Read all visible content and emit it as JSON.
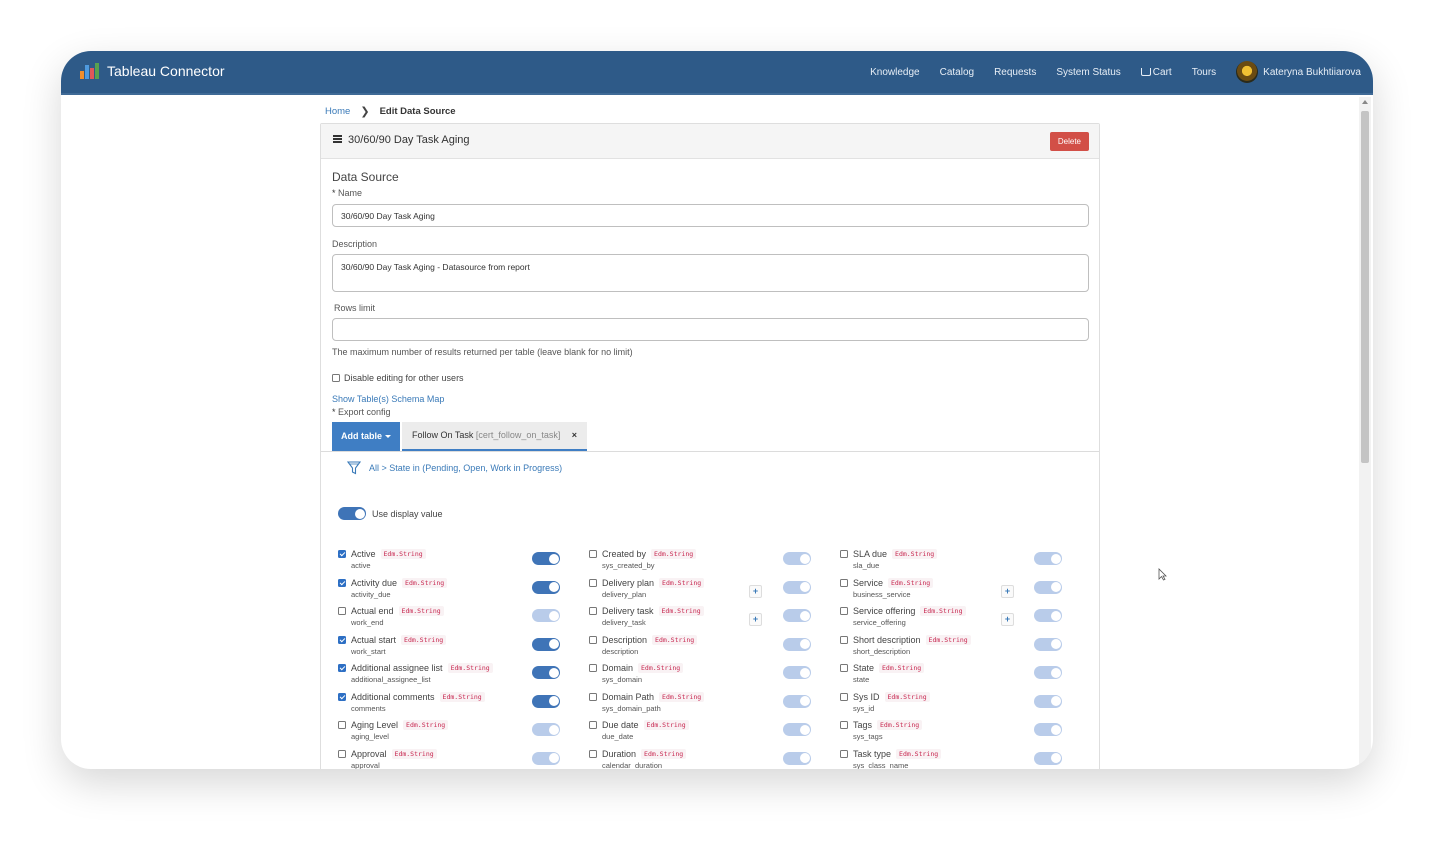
{
  "app": {
    "title": "Tableau Connector"
  },
  "nav": {
    "items": [
      "Knowledge",
      "Catalog",
      "Requests",
      "System Status",
      "Cart",
      "Tours"
    ],
    "user": "Kateryna Bukhtiiarova"
  },
  "breadcrumb": {
    "home": "Home",
    "current": "Edit Data Source"
  },
  "panel": {
    "title": "30/60/90 Day Task Aging",
    "delete_label": "Delete"
  },
  "form": {
    "section_title": "Data Source",
    "name_label": "Name",
    "name_value": "30/60/90 Day Task Aging",
    "description_label": "Description",
    "description_value": "30/60/90 Day Task Aging - Datasource from report",
    "rows_limit_label": "Rows limit",
    "rows_limit_value": "",
    "rows_limit_help": "The maximum number of results returned per table (leave blank for no limit)",
    "disable_editing_label": "Disable editing for other users",
    "schema_link": "Show Table(s) Schema Map",
    "export_config_label": "Export config"
  },
  "tabs": {
    "add_table_label": "Add table",
    "active_tab_name": "Follow On Task",
    "active_tab_table": "[cert_follow_on_task]",
    "close_symbol": "×"
  },
  "filter": {
    "text": "All > State in (Pending, Open, Work in Progress)"
  },
  "display_value": {
    "label": "Use display value",
    "on": true
  },
  "columns": [
    {
      "fields": [
        {
          "label": "Active",
          "type": "Edm.String",
          "sys": "active",
          "checked": true,
          "toggle": true,
          "plus": false
        },
        {
          "label": "Activity due",
          "type": "Edm.String",
          "sys": "activity_due",
          "checked": true,
          "toggle": true,
          "plus": false
        },
        {
          "label": "Actual end",
          "type": "Edm.String",
          "sys": "work_end",
          "checked": false,
          "toggle": false,
          "plus": false
        },
        {
          "label": "Actual start",
          "type": "Edm.String",
          "sys": "work_start",
          "checked": true,
          "toggle": true,
          "plus": false
        },
        {
          "label": "Additional assignee list",
          "type": "Edm.String",
          "sys": "additional_assignee_list",
          "checked": true,
          "toggle": true,
          "plus": false
        },
        {
          "label": "Additional comments",
          "type": "Edm.String",
          "sys": "comments",
          "checked": true,
          "toggle": true,
          "plus": false
        },
        {
          "label": "Aging Level",
          "type": "Edm.String",
          "sys": "aging_level",
          "checked": false,
          "toggle": false,
          "plus": false
        },
        {
          "label": "Approval",
          "type": "Edm.String",
          "sys": "approval",
          "checked": false,
          "toggle": false,
          "plus": false
        }
      ]
    },
    {
      "fields": [
        {
          "label": "Created by",
          "type": "Edm.String",
          "sys": "sys_created_by",
          "checked": false,
          "toggle": false,
          "plus": false
        },
        {
          "label": "Delivery plan",
          "type": "Edm.String",
          "sys": "delivery_plan",
          "checked": false,
          "toggle": false,
          "plus": true
        },
        {
          "label": "Delivery task",
          "type": "Edm.String",
          "sys": "delivery_task",
          "checked": false,
          "toggle": false,
          "plus": true
        },
        {
          "label": "Description",
          "type": "Edm.String",
          "sys": "description",
          "checked": false,
          "toggle": false,
          "plus": false
        },
        {
          "label": "Domain",
          "type": "Edm.String",
          "sys": "sys_domain",
          "checked": false,
          "toggle": false,
          "plus": false
        },
        {
          "label": "Domain Path",
          "type": "Edm.String",
          "sys": "sys_domain_path",
          "checked": false,
          "toggle": false,
          "plus": false
        },
        {
          "label": "Due date",
          "type": "Edm.String",
          "sys": "due_date",
          "checked": false,
          "toggle": false,
          "plus": false
        },
        {
          "label": "Duration",
          "type": "Edm.String",
          "sys": "calendar_duration",
          "checked": false,
          "toggle": false,
          "plus": false
        }
      ]
    },
    {
      "fields": [
        {
          "label": "SLA due",
          "type": "Edm.String",
          "sys": "sla_due",
          "checked": false,
          "toggle": false,
          "plus": false
        },
        {
          "label": "Service",
          "type": "Edm.String",
          "sys": "business_service",
          "checked": false,
          "toggle": false,
          "plus": true
        },
        {
          "label": "Service offering",
          "type": "Edm.String",
          "sys": "service_offering",
          "checked": false,
          "toggle": false,
          "plus": true
        },
        {
          "label": "Short description",
          "type": "Edm.String",
          "sys": "short_description",
          "checked": false,
          "toggle": false,
          "plus": false
        },
        {
          "label": "State",
          "type": "Edm.String",
          "sys": "state",
          "checked": false,
          "toggle": false,
          "plus": false
        },
        {
          "label": "Sys ID",
          "type": "Edm.String",
          "sys": "sys_id",
          "checked": false,
          "toggle": false,
          "plus": false
        },
        {
          "label": "Tags",
          "type": "Edm.String",
          "sys": "sys_tags",
          "checked": false,
          "toggle": false,
          "plus": false
        },
        {
          "label": "Task type",
          "type": "Edm.String",
          "sys": "sys_class_name",
          "checked": false,
          "toggle": false,
          "plus": false
        }
      ]
    }
  ],
  "colors": {
    "navbar": "#2e5a88",
    "accent": "#3f7ec4",
    "danger": "#d24f47",
    "type_tag": "#c7254e"
  },
  "icons": {
    "brand": "tableau-chart-icon",
    "cart": "cart-icon",
    "menu": "hamburger-icon",
    "filter": "funnel-icon",
    "cursor": "mouse-cursor-icon"
  }
}
